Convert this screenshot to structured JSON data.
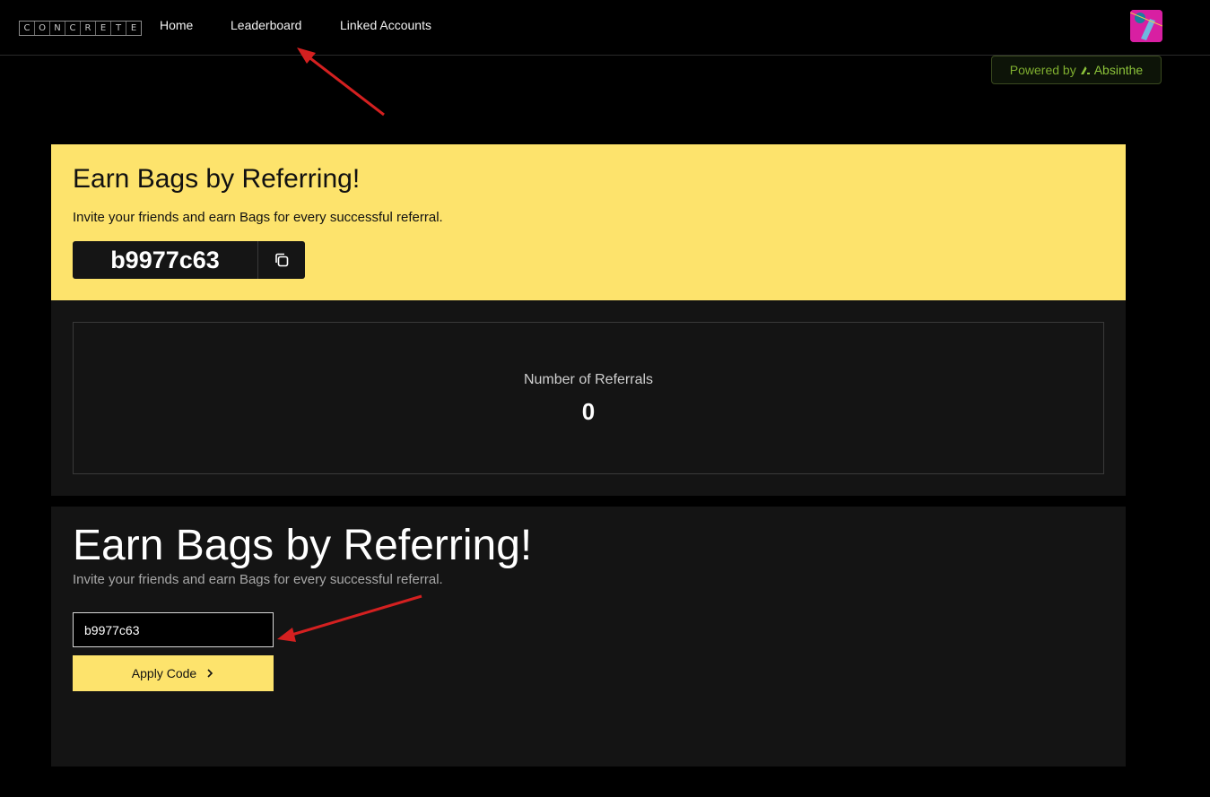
{
  "nav": {
    "logo_letters": [
      "C",
      "O",
      "N",
      "C",
      "R",
      "E",
      "T",
      "E"
    ],
    "links": [
      "Home",
      "Leaderboard",
      "Linked Accounts"
    ],
    "avatar_icon": "user-avatar",
    "powered_label": "Powered by",
    "powered_brand": "Absinthe"
  },
  "hero": {
    "title": "Earn Bags by Referring!",
    "subtitle": "Invite your friends and earn Bags for every successful referral.",
    "referral_code": "b9977c63",
    "copy_icon": "copy-icon"
  },
  "stats": {
    "label": "Number of Referrals",
    "value": "0"
  },
  "apply": {
    "title": "Earn Bags by Referring!",
    "subtitle": "Invite your friends and earn Bags for every successful referral.",
    "input_value": "b9977c63",
    "button_label": "Apply Code",
    "button_icon": "chevron-right-icon"
  },
  "colors": {
    "accent_yellow": "#fde36c",
    "background": "#000000",
    "panel": "#141414",
    "annotation_arrow": "#d42020"
  }
}
